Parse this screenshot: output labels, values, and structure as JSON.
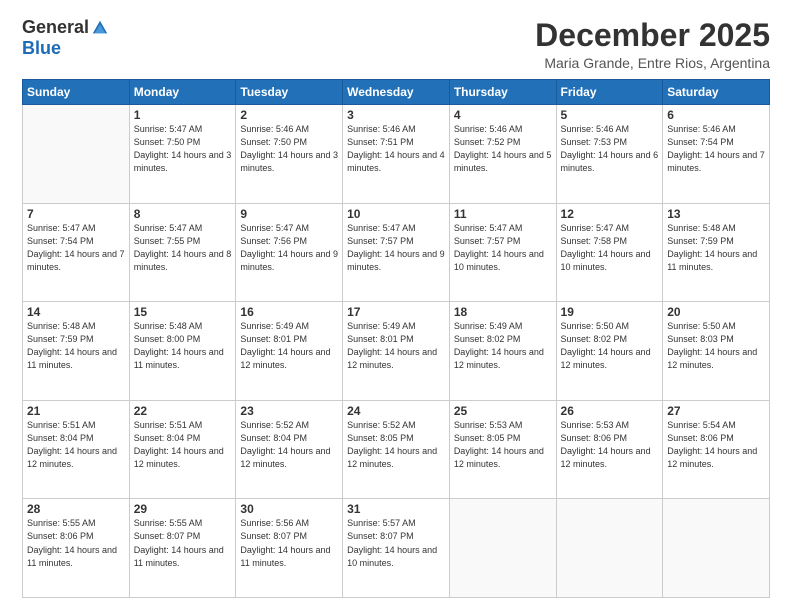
{
  "logo": {
    "general": "General",
    "blue": "Blue"
  },
  "header": {
    "month": "December 2025",
    "location": "Maria Grande, Entre Rios, Argentina"
  },
  "weekdays": [
    "Sunday",
    "Monday",
    "Tuesday",
    "Wednesday",
    "Thursday",
    "Friday",
    "Saturday"
  ],
  "weeks": [
    [
      {
        "day": "",
        "sunrise": "",
        "sunset": "",
        "daylight": ""
      },
      {
        "day": "1",
        "sunrise": "Sunrise: 5:47 AM",
        "sunset": "Sunset: 7:50 PM",
        "daylight": "Daylight: 14 hours and 3 minutes."
      },
      {
        "day": "2",
        "sunrise": "Sunrise: 5:46 AM",
        "sunset": "Sunset: 7:50 PM",
        "daylight": "Daylight: 14 hours and 3 minutes."
      },
      {
        "day": "3",
        "sunrise": "Sunrise: 5:46 AM",
        "sunset": "Sunset: 7:51 PM",
        "daylight": "Daylight: 14 hours and 4 minutes."
      },
      {
        "day": "4",
        "sunrise": "Sunrise: 5:46 AM",
        "sunset": "Sunset: 7:52 PM",
        "daylight": "Daylight: 14 hours and 5 minutes."
      },
      {
        "day": "5",
        "sunrise": "Sunrise: 5:46 AM",
        "sunset": "Sunset: 7:53 PM",
        "daylight": "Daylight: 14 hours and 6 minutes."
      },
      {
        "day": "6",
        "sunrise": "Sunrise: 5:46 AM",
        "sunset": "Sunset: 7:54 PM",
        "daylight": "Daylight: 14 hours and 7 minutes."
      }
    ],
    [
      {
        "day": "7",
        "sunrise": "Sunrise: 5:47 AM",
        "sunset": "Sunset: 7:54 PM",
        "daylight": "Daylight: 14 hours and 7 minutes."
      },
      {
        "day": "8",
        "sunrise": "Sunrise: 5:47 AM",
        "sunset": "Sunset: 7:55 PM",
        "daylight": "Daylight: 14 hours and 8 minutes."
      },
      {
        "day": "9",
        "sunrise": "Sunrise: 5:47 AM",
        "sunset": "Sunset: 7:56 PM",
        "daylight": "Daylight: 14 hours and 9 minutes."
      },
      {
        "day": "10",
        "sunrise": "Sunrise: 5:47 AM",
        "sunset": "Sunset: 7:57 PM",
        "daylight": "Daylight: 14 hours and 9 minutes."
      },
      {
        "day": "11",
        "sunrise": "Sunrise: 5:47 AM",
        "sunset": "Sunset: 7:57 PM",
        "daylight": "Daylight: 14 hours and 10 minutes."
      },
      {
        "day": "12",
        "sunrise": "Sunrise: 5:47 AM",
        "sunset": "Sunset: 7:58 PM",
        "daylight": "Daylight: 14 hours and 10 minutes."
      },
      {
        "day": "13",
        "sunrise": "Sunrise: 5:48 AM",
        "sunset": "Sunset: 7:59 PM",
        "daylight": "Daylight: 14 hours and 11 minutes."
      }
    ],
    [
      {
        "day": "14",
        "sunrise": "Sunrise: 5:48 AM",
        "sunset": "Sunset: 7:59 PM",
        "daylight": "Daylight: 14 hours and 11 minutes."
      },
      {
        "day": "15",
        "sunrise": "Sunrise: 5:48 AM",
        "sunset": "Sunset: 8:00 PM",
        "daylight": "Daylight: 14 hours and 11 minutes."
      },
      {
        "day": "16",
        "sunrise": "Sunrise: 5:49 AM",
        "sunset": "Sunset: 8:01 PM",
        "daylight": "Daylight: 14 hours and 12 minutes."
      },
      {
        "day": "17",
        "sunrise": "Sunrise: 5:49 AM",
        "sunset": "Sunset: 8:01 PM",
        "daylight": "Daylight: 14 hours and 12 minutes."
      },
      {
        "day": "18",
        "sunrise": "Sunrise: 5:49 AM",
        "sunset": "Sunset: 8:02 PM",
        "daylight": "Daylight: 14 hours and 12 minutes."
      },
      {
        "day": "19",
        "sunrise": "Sunrise: 5:50 AM",
        "sunset": "Sunset: 8:02 PM",
        "daylight": "Daylight: 14 hours and 12 minutes."
      },
      {
        "day": "20",
        "sunrise": "Sunrise: 5:50 AM",
        "sunset": "Sunset: 8:03 PM",
        "daylight": "Daylight: 14 hours and 12 minutes."
      }
    ],
    [
      {
        "day": "21",
        "sunrise": "Sunrise: 5:51 AM",
        "sunset": "Sunset: 8:04 PM",
        "daylight": "Daylight: 14 hours and 12 minutes."
      },
      {
        "day": "22",
        "sunrise": "Sunrise: 5:51 AM",
        "sunset": "Sunset: 8:04 PM",
        "daylight": "Daylight: 14 hours and 12 minutes."
      },
      {
        "day": "23",
        "sunrise": "Sunrise: 5:52 AM",
        "sunset": "Sunset: 8:04 PM",
        "daylight": "Daylight: 14 hours and 12 minutes."
      },
      {
        "day": "24",
        "sunrise": "Sunrise: 5:52 AM",
        "sunset": "Sunset: 8:05 PM",
        "daylight": "Daylight: 14 hours and 12 minutes."
      },
      {
        "day": "25",
        "sunrise": "Sunrise: 5:53 AM",
        "sunset": "Sunset: 8:05 PM",
        "daylight": "Daylight: 14 hours and 12 minutes."
      },
      {
        "day": "26",
        "sunrise": "Sunrise: 5:53 AM",
        "sunset": "Sunset: 8:06 PM",
        "daylight": "Daylight: 14 hours and 12 minutes."
      },
      {
        "day": "27",
        "sunrise": "Sunrise: 5:54 AM",
        "sunset": "Sunset: 8:06 PM",
        "daylight": "Daylight: 14 hours and 12 minutes."
      }
    ],
    [
      {
        "day": "28",
        "sunrise": "Sunrise: 5:55 AM",
        "sunset": "Sunset: 8:06 PM",
        "daylight": "Daylight: 14 hours and 11 minutes."
      },
      {
        "day": "29",
        "sunrise": "Sunrise: 5:55 AM",
        "sunset": "Sunset: 8:07 PM",
        "daylight": "Daylight: 14 hours and 11 minutes."
      },
      {
        "day": "30",
        "sunrise": "Sunrise: 5:56 AM",
        "sunset": "Sunset: 8:07 PM",
        "daylight": "Daylight: 14 hours and 11 minutes."
      },
      {
        "day": "31",
        "sunrise": "Sunrise: 5:57 AM",
        "sunset": "Sunset: 8:07 PM",
        "daylight": "Daylight: 14 hours and 10 minutes."
      },
      {
        "day": "",
        "sunrise": "",
        "sunset": "",
        "daylight": ""
      },
      {
        "day": "",
        "sunrise": "",
        "sunset": "",
        "daylight": ""
      },
      {
        "day": "",
        "sunrise": "",
        "sunset": "",
        "daylight": ""
      }
    ]
  ]
}
